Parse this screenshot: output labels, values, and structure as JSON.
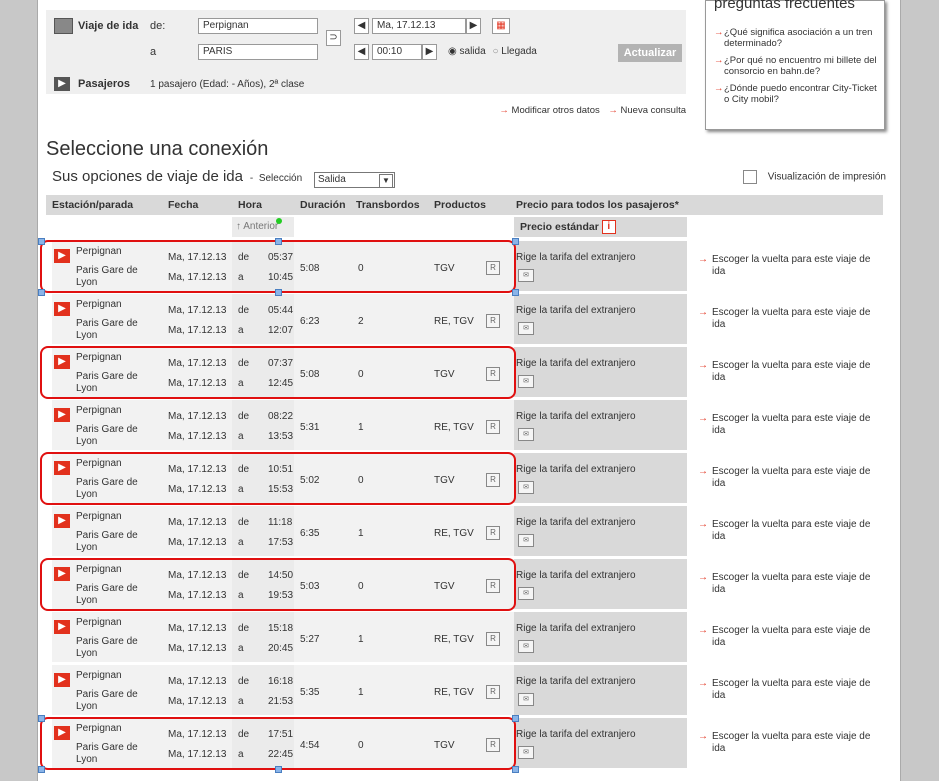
{
  "search": {
    "outbound_label": "Viaje de ida",
    "from_label": "de:",
    "to_label": "a",
    "from_value": "Perpignan",
    "to_value": "PARIS",
    "date_value": "Ma, 17.12.13",
    "time_value": "00:10",
    "departure_label": "salida",
    "arrival_label": "Llegada",
    "update_label": "Actualizar",
    "passengers_label": "Pasajeros",
    "passengers_value": "1 pasajero (Edad: - Años), 2ª clase"
  },
  "links": {
    "modify": "Modificar otros datos",
    "new": "Nueva consulta"
  },
  "faq": {
    "title": "preguntas frecuentes",
    "items": [
      "¿Qué significa asociación a un tren determinado?",
      "¿Por qué no encuentro mi billete del consorcio en bahn.de?",
      "¿Dónde puedo encontrar City-Ticket o City mobil?"
    ]
  },
  "main": {
    "title": "Seleccione una conexión",
    "subtitle": "Sus opciones de viaje de ida",
    "selection_label": "Selección",
    "select_value": "Salida",
    "print_label": "Visualización de impresión"
  },
  "table": {
    "headers": {
      "station": "Estación/parada",
      "date": "Fecha",
      "time": "Hora",
      "duration": "Duración",
      "transfers": "Transbordos",
      "products": "Productos",
      "price": "Precio para todos los pasajeros*"
    },
    "earlier": "Anterior",
    "standard_price": "Precio estándar",
    "rows": [
      {
        "from": "Perpignan",
        "to": "Paris Gare de Lyon",
        "date1": "Ma, 17.12.13",
        "date2": "Ma, 17.12.13",
        "dep": "05:37",
        "arr": "10:45",
        "duration": "5:08",
        "transfers": "0",
        "products": "TGV"
      },
      {
        "from": "Perpignan",
        "to": "Paris Gare de Lyon",
        "date1": "Ma, 17.12.13",
        "date2": "Ma, 17.12.13",
        "dep": "05:44",
        "arr": "12:07",
        "duration": "6:23",
        "transfers": "2",
        "products": "RE, TGV"
      },
      {
        "from": "Perpignan",
        "to": "Paris Gare de Lyon",
        "date1": "Ma, 17.12.13",
        "date2": "Ma, 17.12.13",
        "dep": "07:37",
        "arr": "12:45",
        "duration": "5:08",
        "transfers": "0",
        "products": "TGV"
      },
      {
        "from": "Perpignan",
        "to": "Paris Gare de Lyon",
        "date1": "Ma, 17.12.13",
        "date2": "Ma, 17.12.13",
        "dep": "08:22",
        "arr": "13:53",
        "duration": "5:31",
        "transfers": "1",
        "products": "RE, TGV"
      },
      {
        "from": "Perpignan",
        "to": "Paris Gare de Lyon",
        "date1": "Ma, 17.12.13",
        "date2": "Ma, 17.12.13",
        "dep": "10:51",
        "arr": "15:53",
        "duration": "5:02",
        "transfers": "0",
        "products": "TGV"
      },
      {
        "from": "Perpignan",
        "to": "Paris Gare de Lyon",
        "date1": "Ma, 17.12.13",
        "date2": "Ma, 17.12.13",
        "dep": "11:18",
        "arr": "17:53",
        "duration": "6:35",
        "transfers": "1",
        "products": "RE, TGV"
      },
      {
        "from": "Perpignan",
        "to": "Paris Gare de Lyon",
        "date1": "Ma, 17.12.13",
        "date2": "Ma, 17.12.13",
        "dep": "14:50",
        "arr": "19:53",
        "duration": "5:03",
        "transfers": "0",
        "products": "TGV"
      },
      {
        "from": "Perpignan",
        "to": "Paris Gare de Lyon",
        "date1": "Ma, 17.12.13",
        "date2": "Ma, 17.12.13",
        "dep": "15:18",
        "arr": "20:45",
        "duration": "5:27",
        "transfers": "1",
        "products": "RE, TGV"
      },
      {
        "from": "Perpignan",
        "to": "Paris Gare de Lyon",
        "date1": "Ma, 17.12.13",
        "date2": "Ma, 17.12.13",
        "dep": "16:18",
        "arr": "21:53",
        "duration": "5:35",
        "transfers": "1",
        "products": "RE, TGV"
      },
      {
        "from": "Perpignan",
        "to": "Paris Gare de Lyon",
        "date1": "Ma, 17.12.13",
        "date2": "Ma, 17.12.13",
        "dep": "17:51",
        "arr": "22:45",
        "duration": "4:54",
        "transfers": "0",
        "products": "TGV"
      }
    ],
    "from_word": "de",
    "to_word": "a",
    "price_text": "Rige la tarifa del extranjero",
    "return_text": "Escoger la vuelta para este viaje de ida"
  },
  "colors": {
    "accent": "#e2311d",
    "highlight": "#e01010"
  }
}
